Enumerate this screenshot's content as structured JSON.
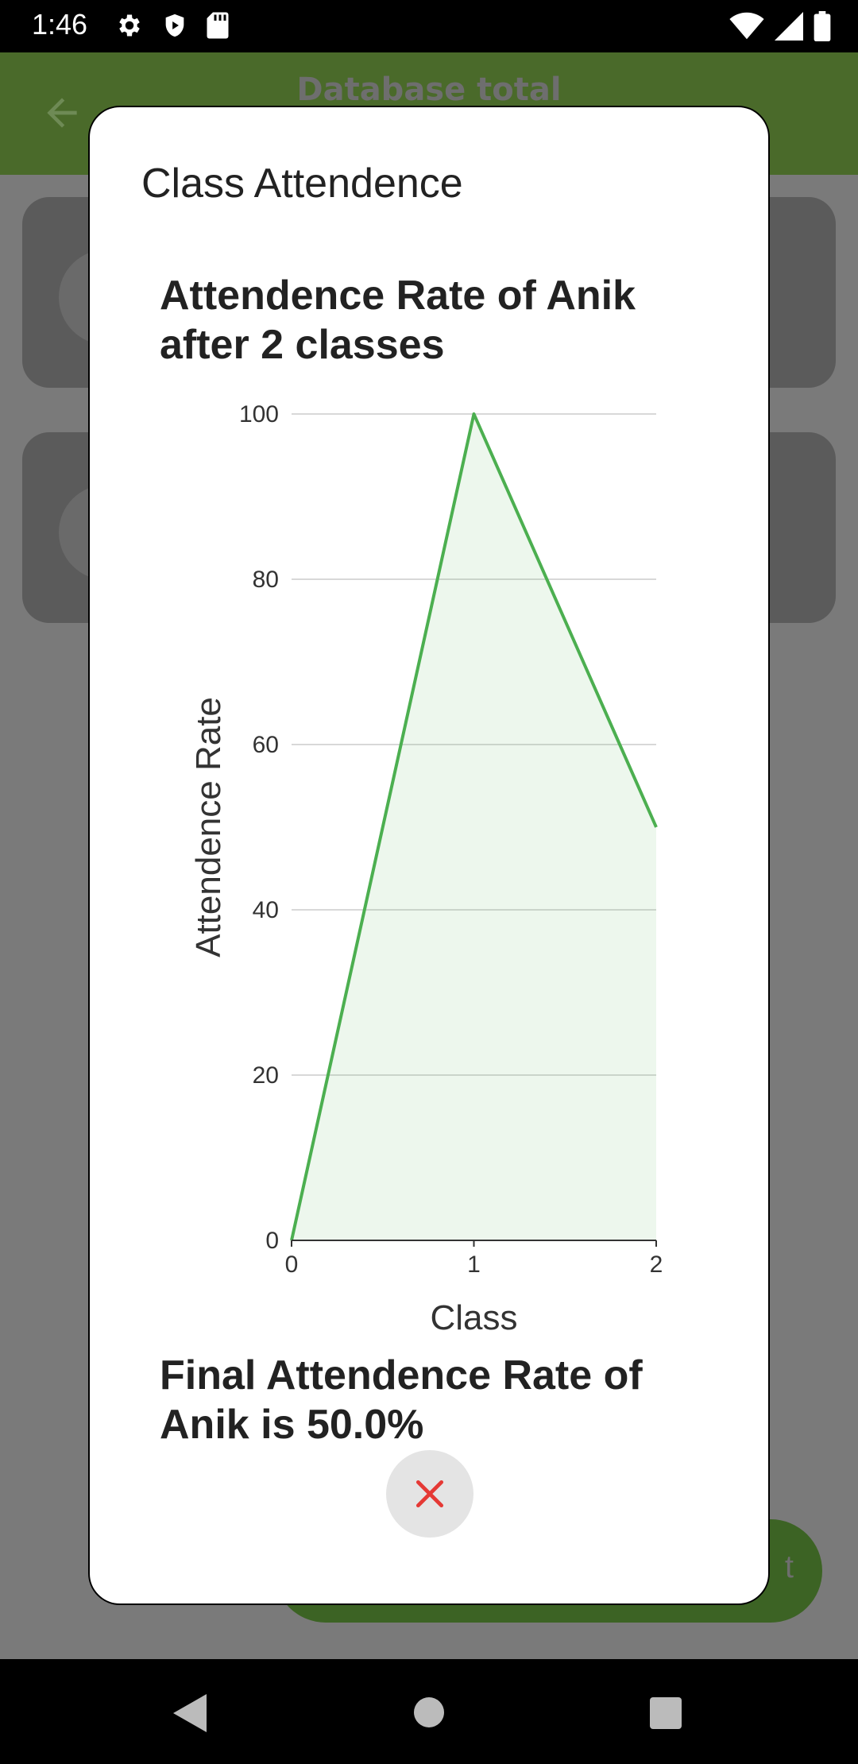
{
  "status_bar": {
    "time": "1:46",
    "icons": [
      "gear-icon",
      "shield-play-icon",
      "sd-card-icon",
      "wifi-icon",
      "signal-icon",
      "battery-icon"
    ]
  },
  "app_bar": {
    "title": "Database total",
    "color": "#4a6a2a"
  },
  "background": {
    "fab_label": "t"
  },
  "dialog": {
    "title": "Class Attendence",
    "chart_heading": "Attendence Rate of Anik after 2 classes",
    "final_text": "Final Attendence Rate of Anik is 50.0%",
    "close_icon": "close-icon"
  },
  "chart_data": {
    "type": "area",
    "x": [
      0,
      1,
      2
    ],
    "series": [
      {
        "values": [
          0,
          100,
          50
        ],
        "color": "#4caf50"
      }
    ],
    "xlabel": "Class",
    "ylabel": "Attendence Rate",
    "xlim": [
      0,
      2
    ],
    "ylim": [
      0,
      100
    ],
    "yticks": [
      0,
      20,
      40,
      60,
      80,
      100
    ],
    "xticks": [
      0,
      1,
      2
    ],
    "grid": true
  },
  "nav_bar": {
    "icons": [
      "back-icon",
      "home-icon",
      "recents-icon"
    ]
  }
}
